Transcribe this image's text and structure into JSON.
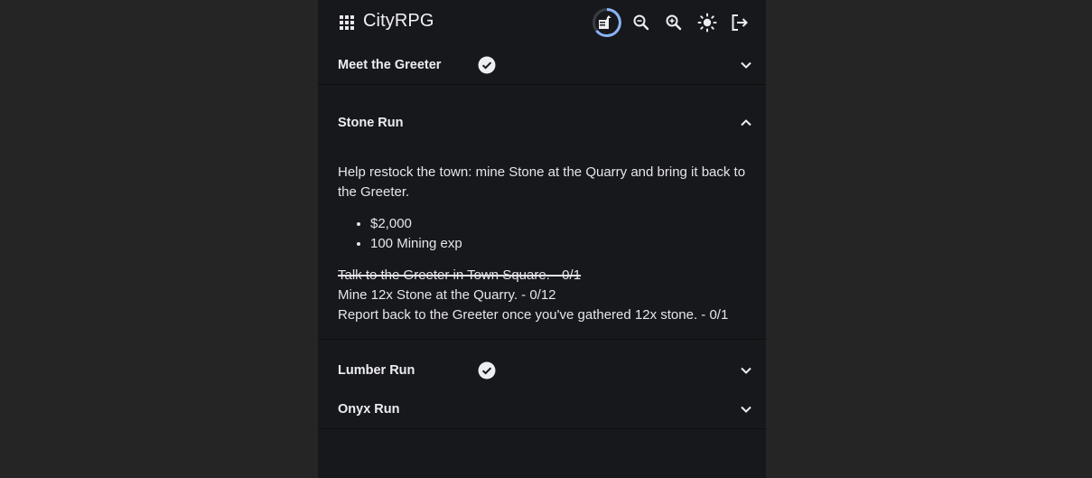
{
  "app": {
    "title": "CityRPG",
    "colors": {
      "page_bg": "#252525",
      "surface": "#17181c",
      "text": "#e8e8ec",
      "accent": "#8ab4f8"
    }
  },
  "toolbar": {
    "menu_icon": "apps-grid-icon",
    "progress_icon": "quest-progress-ring-icon",
    "zoom_out_icon": "zoom-out-icon",
    "zoom_in_icon": "zoom-in-icon",
    "theme_icon": "sun-brightness-icon",
    "logout_icon": "logout-icon"
  },
  "quests": [
    {
      "title": "Meet the Greeter",
      "completed": true,
      "expanded": false
    },
    {
      "title": "Stone Run",
      "completed": false,
      "expanded": true,
      "description": "Help restock the town: mine Stone at the Quarry and bring it back to the Greeter.",
      "rewards": [
        "$2,000",
        "100 Mining exp"
      ],
      "objectives": [
        {
          "text": "Talk to the Greeter in Town Square. - 0/1",
          "done": true
        },
        {
          "text": "Mine 12x Stone at the Quarry. - 0/12",
          "done": false
        },
        {
          "text": "Report back to the Greeter once you've gathered 12x stone. - 0/1",
          "done": false
        }
      ]
    },
    {
      "title": "Lumber Run",
      "completed": true,
      "expanded": false
    },
    {
      "title": "Onyx Run",
      "completed": false,
      "expanded": false
    }
  ]
}
